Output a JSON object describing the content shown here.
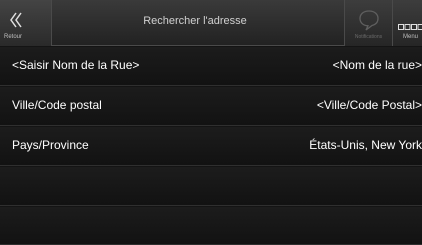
{
  "header": {
    "back_label": "Retour",
    "title": "Rechercher l'adresse",
    "notifications_label": "Notifications",
    "menu_label": "Menu"
  },
  "rows": [
    {
      "label": "<Saisir Nom de la Rue>",
      "value": "<Nom de la rue>"
    },
    {
      "label": "Ville/Code postal",
      "value": "<Ville/Code Postal>"
    },
    {
      "label": "Pays/Province",
      "value": "États-Unis, New York"
    },
    {
      "label": "",
      "value": ""
    },
    {
      "label": "",
      "value": ""
    }
  ],
  "icons": {
    "back": "double-chevron-left-icon",
    "notifications": "speech-bubble-icon",
    "menu": "grid-icon"
  },
  "colors": {
    "background": "#141414",
    "header": "#2c2c2c",
    "text": "#ffffff",
    "disabled_text": "#6a6a6a"
  }
}
